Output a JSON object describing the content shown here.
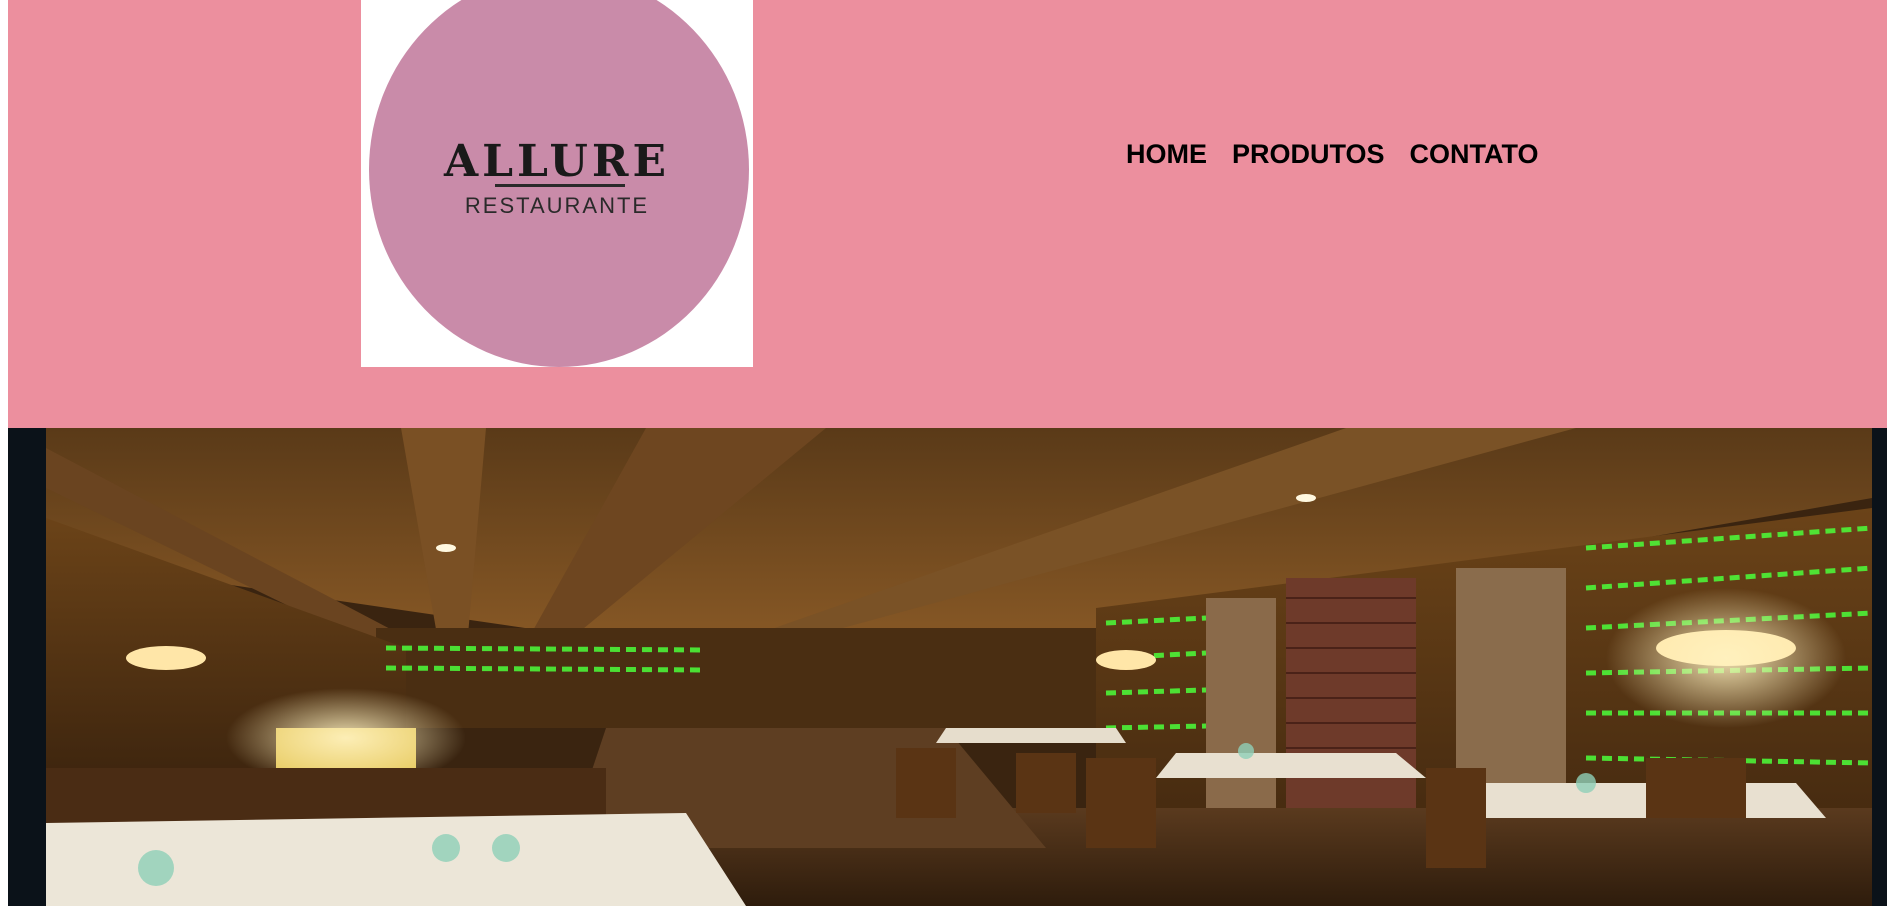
{
  "logo": {
    "title": "ALLURE",
    "subtitle": "RESTAURANTE"
  },
  "nav": {
    "items": [
      {
        "label": "HOME"
      },
      {
        "label": "PRODUTOS"
      },
      {
        "label": "CONTATO"
      }
    ]
  },
  "hero": {
    "image_subject": "restaurant-interior-photo"
  },
  "colors": {
    "header_bg": "#ec8f9e",
    "logo_circle": "#c98ba9",
    "hero_frame": "#0b1219"
  }
}
